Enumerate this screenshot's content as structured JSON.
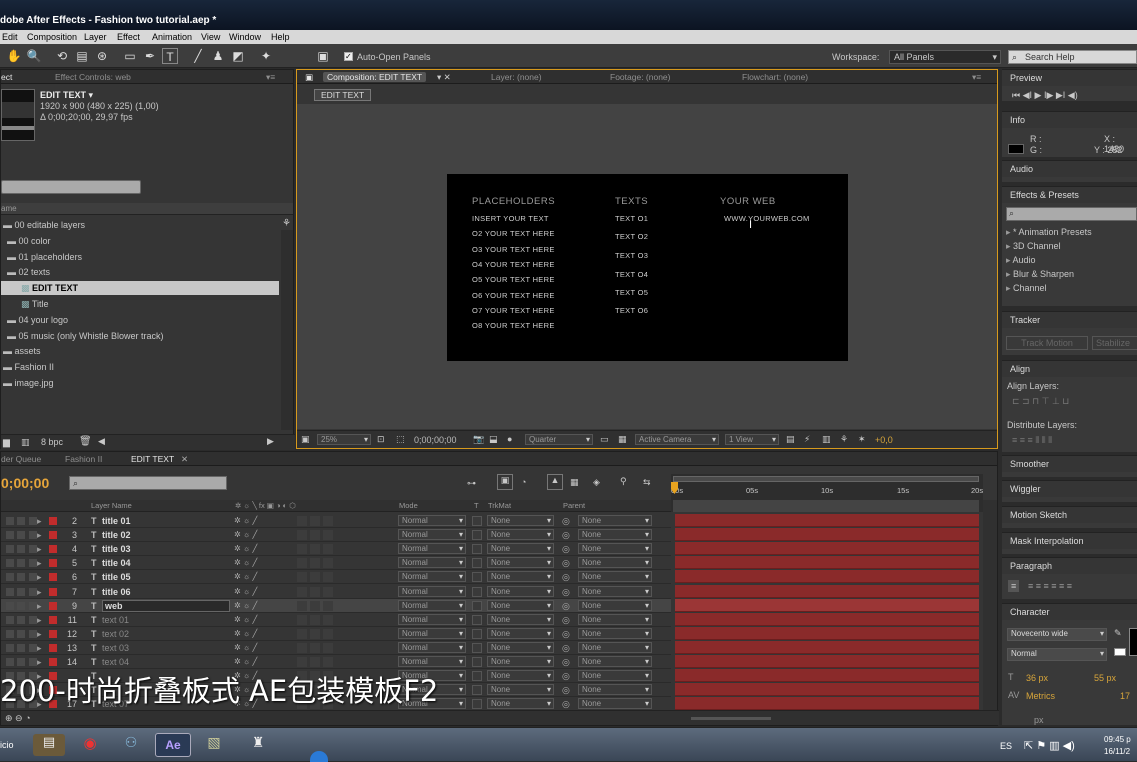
{
  "window": {
    "title": "dobe After Effects - Fashion two tutorial.aep *"
  },
  "menu": [
    "Edit",
    "Composition",
    "Layer",
    "Effect",
    "Animation",
    "View",
    "Window",
    "Help"
  ],
  "toolbar": {
    "auto_open_label": "Auto-Open Panels",
    "workspace_label": "Workspace:",
    "workspace_value": "All Panels",
    "search_placeholder": "Search Help"
  },
  "project": {
    "tabs": [
      "ect",
      "Effect Controls: web"
    ],
    "item_name": "EDIT TEXT ▾",
    "item_res": "1920 x 900  (480 x 225) (1,00)",
    "item_dur": "Δ 0;00;20;00, 29,97 fps",
    "col_name": "ame",
    "tree": [
      {
        "label": "00 editable layers",
        "indent": 0
      },
      {
        "label": "00 color",
        "indent": 1
      },
      {
        "label": "01 placeholders",
        "indent": 1
      },
      {
        "label": "02 texts",
        "indent": 1
      },
      {
        "label": "EDIT TEXT",
        "indent": 2,
        "selected": true
      },
      {
        "label": "Title",
        "indent": 2
      },
      {
        "label": "04 your logo",
        "indent": 1
      },
      {
        "label": "05 music (only Whistle Blower track)",
        "indent": 1
      },
      {
        "label": "assets",
        "indent": 0
      },
      {
        "label": "Fashion II",
        "indent": 0
      },
      {
        "label": "image.jpg",
        "indent": 0
      }
    ],
    "bpc": "8 bpc"
  },
  "comp": {
    "tabs": [
      "Composition: EDIT TEXT",
      "Layer: (none)",
      "Footage: (none)",
      "Flowchart: (none)"
    ],
    "sub_tab": "EDIT TEXT",
    "canvas": {
      "col1_head": "PLACEHOLDERS",
      "col2_head": "TEXTS",
      "col3_head": "YOUR WEB",
      "col1": [
        "INSERT YOUR TEXT",
        "O2 YOUR TEXT HERE",
        "O3 YOUR TEXT HERE",
        "O4 YOUR TEXT HERE",
        "O5 YOUR TEXT HERE",
        "O6 YOUR TEXT HERE",
        "O7 YOUR TEXT HERE",
        "O8 YOUR TEXT HERE"
      ],
      "col2": [
        "TEXT O1",
        "TEXT O2",
        "TEXT O3",
        "TEXT O4",
        "TEXT O5",
        "TEXT O6"
      ],
      "web": "WWW.YOURWEB.COM"
    },
    "zoom": "25%",
    "timecode": "0;00;00;00",
    "resolution": "Quarter",
    "camera": "Active Camera",
    "view": "1 View",
    "exposure": "+0,0"
  },
  "timeline": {
    "tabs": [
      "der Queue",
      "Fashion II",
      "EDIT TEXT"
    ],
    "timecode": "0;00;00",
    "headers": {
      "layer_name": "Layer Name",
      "mode": "Mode",
      "t": "T",
      "trkmat": "TrkMat",
      "parent": "Parent"
    },
    "ruler": [
      "00s",
      "05s",
      "10s",
      "15s",
      "20s"
    ],
    "layers": [
      {
        "num": "2",
        "name": "title 01",
        "bold": true
      },
      {
        "num": "3",
        "name": "title 02",
        "bold": true
      },
      {
        "num": "4",
        "name": "title 03",
        "bold": true
      },
      {
        "num": "5",
        "name": "title 04",
        "bold": true
      },
      {
        "num": "6",
        "name": "title 05",
        "bold": true
      },
      {
        "num": "7",
        "name": "title 06",
        "bold": true
      },
      {
        "num": "9",
        "name": "web",
        "bold": true,
        "selected": true
      },
      {
        "num": "11",
        "name": "text 01",
        "bold": false
      },
      {
        "num": "12",
        "name": "text 02",
        "bold": false
      },
      {
        "num": "13",
        "name": "text 03",
        "bold": false
      },
      {
        "num": "14",
        "name": "text 04",
        "bold": false
      },
      {
        "num": "",
        "name": "",
        "bold": false
      },
      {
        "num": "",
        "name": "",
        "bold": false
      },
      {
        "num": "17",
        "name": "text 07",
        "bold": false
      }
    ],
    "mode_value": "Normal",
    "trk_value": "None",
    "parent_value": "None"
  },
  "right": {
    "preview": "Preview",
    "info": "Info",
    "info_r": "R :",
    "info_g": "G :",
    "info_x": "X : 1480",
    "info_y": "Y : 252",
    "audio": "Audio",
    "effects": "Effects & Presets",
    "effects_list": [
      "* Animation Presets",
      "3D Channel",
      "Audio",
      "Blur & Sharpen",
      "Channel"
    ],
    "tracker": "Tracker",
    "track_motion": "Track Motion",
    "stabilize": "Stabilize M",
    "align": "Align",
    "align_layers": "Align Layers:",
    "distribute": "Distribute Layers:",
    "smoother": "Smoother",
    "wiggler": "Wiggler",
    "motion_sketch": "Motion Sketch",
    "mask_interp": "Mask Interpolation",
    "paragraph": "Paragraph",
    "character": "Character",
    "font": "Novecento wide",
    "style": "Normal",
    "size": "36 px",
    "leading": "55 px",
    "metrics": "Metrics",
    "tracking": "17",
    "px": "px"
  },
  "overlay": "200-时尚折叠板式 AE包装模板F2",
  "taskbar": {
    "start": "icio",
    "lang": "ES",
    "time": "09:45 p",
    "date": "16/11/2"
  }
}
